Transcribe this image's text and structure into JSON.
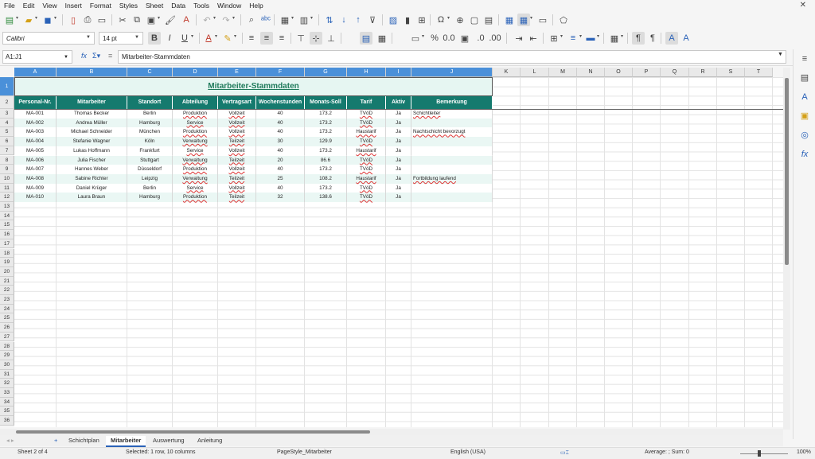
{
  "menu": [
    "File",
    "Edit",
    "View",
    "Insert",
    "Format",
    "Styles",
    "Sheet",
    "Data",
    "Tools",
    "Window",
    "Help"
  ],
  "font": {
    "name": "Calibri",
    "size": "14 pt"
  },
  "formula": {
    "cell_ref": "A1:J1",
    "content": "Mitarbeiter-Stammdaten"
  },
  "columns": [
    "A",
    "B",
    "C",
    "D",
    "E",
    "F",
    "G",
    "H",
    "I",
    "J",
    "K",
    "L",
    "M",
    "N",
    "O",
    "P",
    "Q",
    "R",
    "S",
    "T"
  ],
  "rows": [
    "1",
    "2",
    "3",
    "4",
    "5",
    "6",
    "7",
    "8",
    "9",
    "10",
    "11",
    "12",
    "13",
    "14",
    "15",
    "16",
    "17",
    "18",
    "19",
    "20",
    "21",
    "22",
    "23",
    "24",
    "25",
    "26",
    "27",
    "28",
    "29",
    "30",
    "31",
    "32",
    "33",
    "34",
    "35",
    "36"
  ],
  "sheet": {
    "title": "Mitarbeiter-Stammdaten",
    "headers": [
      "Personal-Nr.",
      "Mitarbeiter",
      "Standort",
      "Abteilung",
      "Vertragsart",
      "Wochenstunden",
      "Monats-Soll",
      "Tarif",
      "Aktiv",
      "Bemerkung"
    ],
    "rows": [
      [
        "MA-001",
        "Thomas Becker",
        "Berlin",
        "Produktion",
        "Vollzeit",
        "40",
        "173.2",
        "TVöD",
        "Ja",
        "Schichtleiter"
      ],
      [
        "MA-002",
        "Andrea Müller",
        "Hamburg",
        "Service",
        "Vollzeit",
        "40",
        "173.2",
        "TVöD",
        "Ja",
        ""
      ],
      [
        "MA-003",
        "Michael Schneider",
        "München",
        "Produktion",
        "Vollzeit",
        "40",
        "173.2",
        "Haustarif",
        "Ja",
        "Nachtschicht bevorzugt"
      ],
      [
        "MA-004",
        "Stefanie Wagner",
        "Köln",
        "Verwaltung",
        "Teilzeit",
        "30",
        "129.9",
        "TVöD",
        "Ja",
        ""
      ],
      [
        "MA-005",
        "Lukas Hoffmann",
        "Frankfurt",
        "Service",
        "Vollzeit",
        "40",
        "173.2",
        "Haustarif",
        "Ja",
        ""
      ],
      [
        "MA-006",
        "Julia Fischer",
        "Stuttgart",
        "Verwaltung",
        "Teilzeit",
        "20",
        "86.6",
        "TVöD",
        "Ja",
        ""
      ],
      [
        "MA-007",
        "Hannes Weber",
        "Düsseldorf",
        "Produktion",
        "Vollzeit",
        "40",
        "173.2",
        "TVöD",
        "Ja",
        ""
      ],
      [
        "MA-008",
        "Sabine Richter",
        "Leipzig",
        "Verwaltung",
        "Teilzeit",
        "25",
        "108.2",
        "Haustarif",
        "Ja",
        "Fortbildung laufend"
      ],
      [
        "MA-009",
        "Daniel Krüger",
        "Berlin",
        "Service",
        "Vollzeit",
        "40",
        "173.2",
        "TVöD",
        "Ja",
        ""
      ],
      [
        "MA-010",
        "Laura Braun",
        "Hamburg",
        "Produktion",
        "Teilzeit",
        "32",
        "138.6",
        "TVöD",
        "Ja",
        ""
      ]
    ]
  },
  "tabs": [
    "Schichtplan",
    "Mitarbeiter",
    "Auswertung",
    "Anleitung"
  ],
  "active_tab": "Mitarbeiter",
  "status": {
    "sheet": "Sheet 2 of 4",
    "selection": "Selected: 1 row, 10 columns",
    "page_style": "PageStyle_Mitarbeiter",
    "language": "English (USA)",
    "summary": "Average: ; Sum: 0",
    "zoom": "100%"
  },
  "colors": {
    "header_bg": "#157a6e",
    "title_bg": "#e6f6f2",
    "title_text": "#1e7a5a",
    "alt_row": "#eaf7f4",
    "selection": "#4a90d9"
  }
}
